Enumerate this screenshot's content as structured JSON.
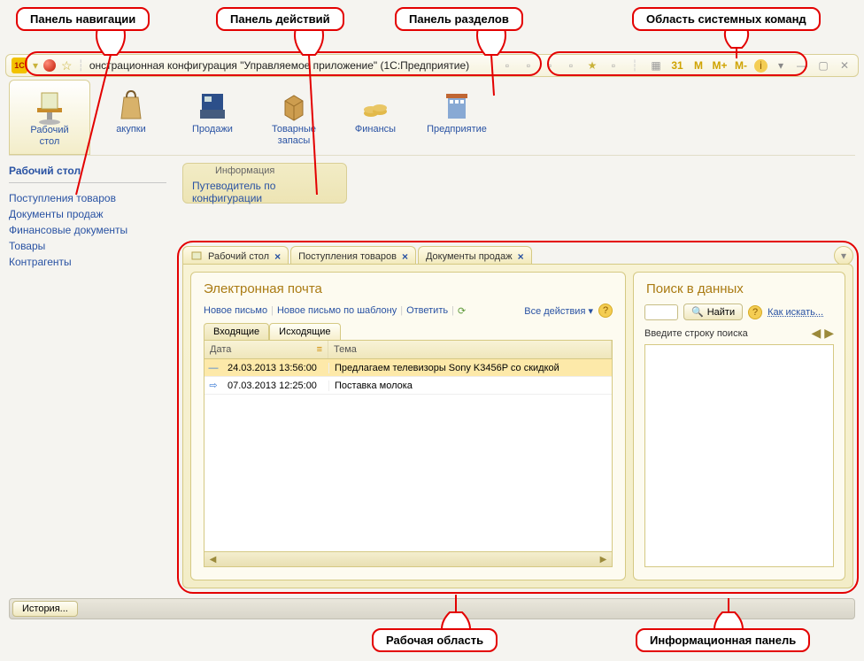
{
  "callouts": {
    "nav_panel": "Панель навигации",
    "action_panel": "Панель действий",
    "section_panel": "Панель разделов",
    "system_commands": "Область системных команд",
    "work_area": "Рабочая область",
    "info_panel": "Информационная панель"
  },
  "titlebar": {
    "logo": "1С",
    "title": "онстрационная конфигурация \"Управляемое приложение\"  (1С:Предприятие)",
    "m": "M",
    "mplus": "M+",
    "mminus": "M-",
    "date": "31"
  },
  "sections": [
    {
      "key": "desktop",
      "label": "Рабочий\nстол"
    },
    {
      "key": "zakupki",
      "label": "акупки"
    },
    {
      "key": "prodazhi",
      "label": "Продажи"
    },
    {
      "key": "tovarnye",
      "label": "Товарные\nзапасы"
    },
    {
      "key": "finansy",
      "label": "Финансы"
    },
    {
      "key": "predpr",
      "label": "Предприятие"
    }
  ],
  "leftnav": {
    "heading": "Рабочий стол",
    "items": [
      "Поступления товаров",
      "Документы продаж",
      "Финансовые документы",
      "Товары",
      "Контрагенты"
    ]
  },
  "actionpanel": {
    "title": "Информация",
    "link": "Путеводитель по конфигурации"
  },
  "tabs": [
    "Рабочий стол",
    "Поступления товаров",
    "Документы продаж"
  ],
  "email": {
    "title": "Электронная почта",
    "toolbar": {
      "new_mail": "Новое письмо",
      "new_mail_tpl": "Новое письмо по шаблону",
      "reply": "Ответить",
      "all_actions": "Все действия"
    },
    "inner_tabs": {
      "inbox": "Входящие",
      "outbox": "Исходящие"
    },
    "columns": {
      "date": "Дата",
      "subject": "Тема"
    },
    "rows": [
      {
        "date": "24.03.2013 13:56:00",
        "subject": "Предлагаем телевизоры Sony K3456P со скидкой",
        "selected": true
      },
      {
        "date": "07.03.2013 12:25:00",
        "subject": "Поставка молока",
        "selected": false
      }
    ]
  },
  "search": {
    "title": "Поиск в данных",
    "find_btn": "Найти",
    "how_link": "Как искать...",
    "label": "Введите строку поиска"
  },
  "history_btn": "История..."
}
